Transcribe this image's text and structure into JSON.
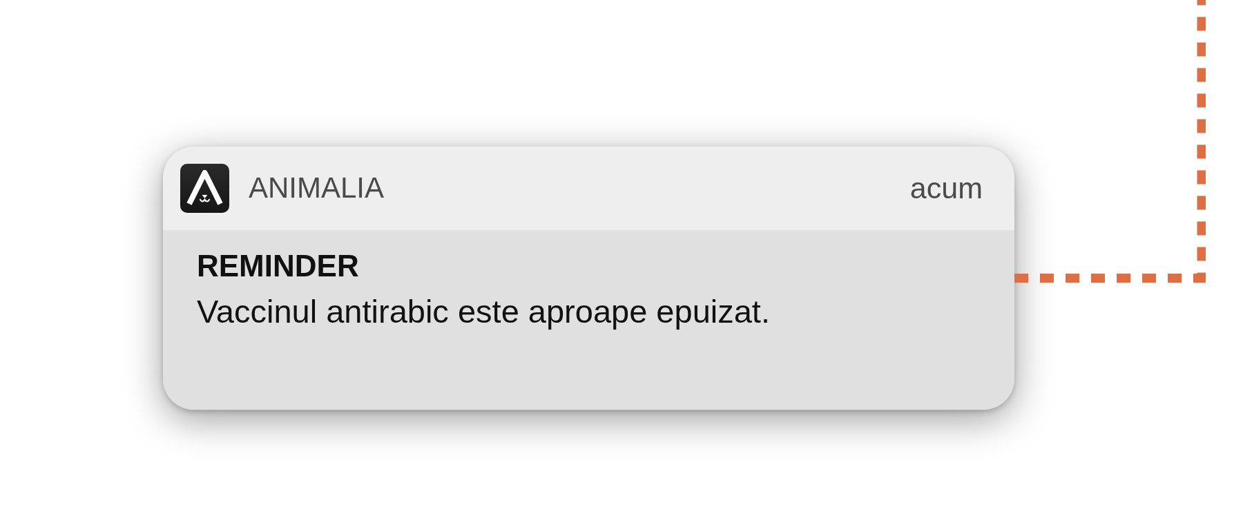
{
  "notification": {
    "app_name": "ANIMALIA",
    "time": "acum",
    "title": "REMINDER",
    "message": "Vaccinul antirabic este aproape epuizat."
  }
}
